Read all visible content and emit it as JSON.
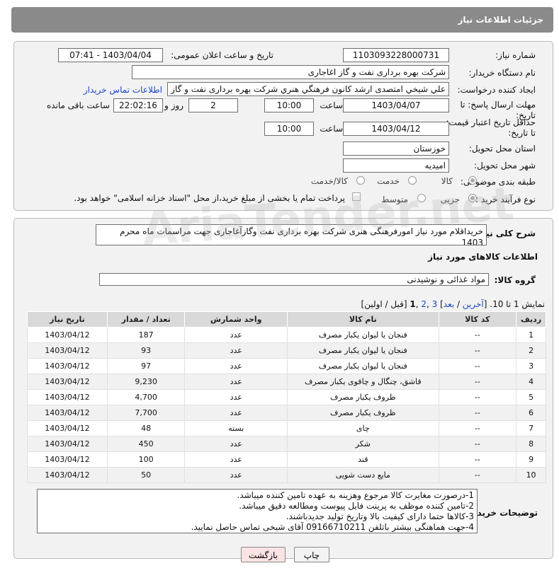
{
  "header": {
    "title": "جزئیات اطلاعات نیاز"
  },
  "form": {
    "need_number_label": "شماره نیاز:",
    "need_number": "1103093228000731",
    "announce_label": "تاریخ و ساعت اعلان عمومی:",
    "announce_value": "1403/04/04 - 07:41",
    "buyer_org_label": "نام دستگاه خریدار:",
    "buyer_org": "شرکت بهره برداری نفت و گاز اغاجاری",
    "creator_label": "ایجاد کننده درخواست:",
    "creator": "علي شيخي امتصدی ارشد کانون فرهنگي هنري شرکت بهره برداری نفت و گاز ا",
    "contact_link": "اطلاعات تماس خریدار",
    "reply_deadline_label": "مهلت ارسال پاسخ: تا تاریخ:",
    "reply_date": "1403/04/07",
    "time_label": "ساعت",
    "reply_time": "10:00",
    "days_value": "2",
    "days_label": "روز و",
    "remaining_time": "22:02:16",
    "remaining_label": "ساعت باقی مانده",
    "price_validity_label": "حداقل تاریخ اعتبار قیمت: تا تاریخ:",
    "price_date": "1403/04/12",
    "price_time": "10:00",
    "province_label": "استان محل تحویل:",
    "province": "خوزستان",
    "city_label": "شهر محل تحویل:",
    "city": "امیدیه",
    "category_label": "طبقه بندی موضوعی:",
    "category_options": [
      "کالا",
      "خدمت",
      "کالا/خدمت"
    ],
    "process_label": "نوع فرآیند خرید :",
    "process_options": [
      "جزیی",
      "متوسط"
    ],
    "payment_note": "پرداخت تمام یا بخشی از مبلغ خرید،از محل \"اسناد خزانه اسلامی\" خواهد بود."
  },
  "summary": {
    "label": "شرح کلی نیاز:",
    "text": "خریداقلام مورد نیاز امورفرهنگی هنری شرکت بهره برداری نفت وگازآغاجاری جهت مراسمات ماه محرم 1403",
    "goods_info_title": "اطلاعات کالاهای مورد نیاز",
    "goods_group_label": "گروه کالا:",
    "goods_group": "مواد غذائی و نوشیدنی"
  },
  "pagination": {
    "prefix": "نمایش 1 تا 10. [",
    "last": "آخرین",
    "sep1": " / ",
    "next": "بعد",
    "sep2": "] ",
    "page3": "3",
    "comma1": " ,",
    "page2": "2",
    "comma2": " ,",
    "page1": "1",
    "suffix": " [قبل / اولین]"
  },
  "table": {
    "headers": [
      "ردیف",
      "کد کالا",
      "نام کالا",
      "واحد شمارش",
      "تعداد / مقدار",
      "تاریخ نیاز"
    ],
    "rows": [
      [
        "1",
        "--",
        "فنجان یا لیوان یکبار مصرف",
        "عدد",
        "187",
        "1403/04/12"
      ],
      [
        "2",
        "--",
        "فنجان یا لیوان یکبار مصرف",
        "عدد",
        "93",
        "1403/04/12"
      ],
      [
        "3",
        "--",
        "فنجان یا لیوان یکبار مصرف",
        "عدد",
        "97",
        "1403/04/12"
      ],
      [
        "4",
        "--",
        "قاشق، چنگال و چاقوی یکبار مصرف",
        "عدد",
        "9,230",
        "1403/04/12"
      ],
      [
        "5",
        "--",
        "ظروف یکبار مصرف",
        "عدد",
        "4,700",
        "1403/04/12"
      ],
      [
        "6",
        "--",
        "ظروف یکبار مصرف",
        "عدد",
        "7,700",
        "1403/04/12"
      ],
      [
        "7",
        "--",
        "چای",
        "بسته",
        "48",
        "1403/04/12"
      ],
      [
        "8",
        "--",
        "شکر",
        "عدد",
        "450",
        "1403/04/12"
      ],
      [
        "9",
        "--",
        "قند",
        "عدد",
        "100",
        "1403/04/12"
      ],
      [
        "10",
        "--",
        "مایع دست شویی",
        "عدد",
        "50",
        "1403/04/12"
      ]
    ]
  },
  "notes": {
    "label": "توضیحات خریدار:",
    "lines": [
      "1-درصورت مغایرت کالا مرجوع وهزینه به عهده تامین کننده میباشد.",
      "2-تامین کننده موظف به پرینت فایل پیوست ومطالعه دقیق میباشد.",
      "3-کالاها حتما دارای کیفیت بالا وتاریخ تولید جدیدباشند.",
      "4-جهت هماهنگی بیشتر باتلفن 09166710211 آقای شیخی تماس حاصل نمایید."
    ]
  },
  "buttons": {
    "print": "چاپ",
    "back": "بازگشت"
  },
  "watermark": "AriaTender.net"
}
